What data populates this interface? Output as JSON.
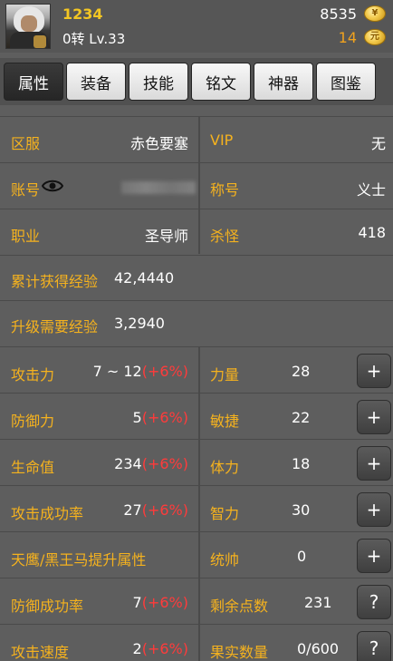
{
  "header": {
    "player_name": "1234",
    "level_text": "0转 Lv.33",
    "money": "8535",
    "ingot": "14"
  },
  "tabs": [
    {
      "label": "属性",
      "active": true
    },
    {
      "label": "装备",
      "active": false
    },
    {
      "label": "技能",
      "active": false
    },
    {
      "label": "铭文",
      "active": false
    },
    {
      "label": "神器",
      "active": false
    },
    {
      "label": "图鉴",
      "active": false
    }
  ],
  "info": {
    "server_label": "区服",
    "server_value": "赤色要塞",
    "vip_label": "VIP",
    "vip_value": "无",
    "account_label": "账号",
    "title_label": "称号",
    "title_value": "义士",
    "job_label": "职业",
    "job_value": "圣导师",
    "kills_label": "杀怪",
    "kills_value": "418",
    "total_exp_label": "累计获得经验",
    "total_exp_value": "42,4440",
    "need_exp_label": "升级需要经验",
    "need_exp_value": "3,2940"
  },
  "stats": [
    {
      "left_label": "攻击力",
      "left_value": "7 ~ 12",
      "left_bonus": "(+6%)",
      "right_label": "力量",
      "right_value": "28",
      "button": "+"
    },
    {
      "left_label": "防御力",
      "left_value": "5",
      "left_bonus": "(+6%)",
      "right_label": "敏捷",
      "right_value": "22",
      "button": "+"
    },
    {
      "left_label": "生命值",
      "left_value": "234",
      "left_bonus": "(+6%)",
      "right_label": "体力",
      "right_value": "18",
      "button": "+"
    },
    {
      "left_label": "攻击成功率",
      "left_value": "27",
      "left_bonus": "(+6%)",
      "right_label": "智力",
      "right_value": "30",
      "button": "+"
    },
    {
      "left_label": "天鹰/黑王马提升属性",
      "left_value": "",
      "left_bonus": "",
      "right_label": "统帅",
      "right_value": "0",
      "button": "+"
    },
    {
      "left_label": "防御成功率",
      "left_value": "7",
      "left_bonus": "(+6%)",
      "right_label": "剩余点数",
      "right_value": "231",
      "button": "?"
    },
    {
      "left_label": "攻击速度",
      "left_value": "2",
      "left_bonus": "(+6%)",
      "right_label": "果实数量",
      "right_value": "0/600",
      "button": "?"
    }
  ]
}
